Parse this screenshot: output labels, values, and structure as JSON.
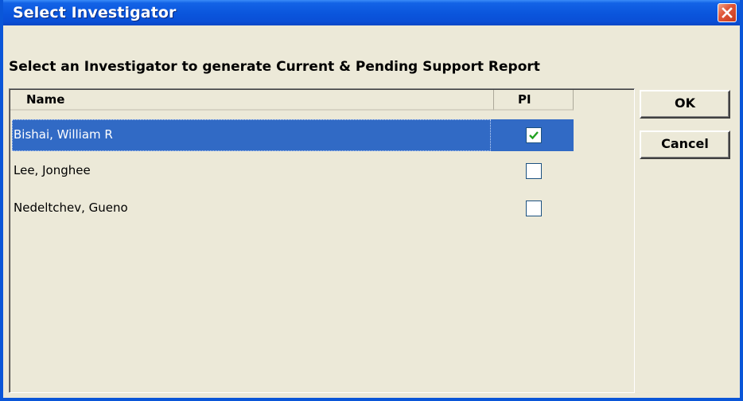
{
  "window": {
    "title": "Select Investigator"
  },
  "instructions": "Select an Investigator to generate Current & Pending Support Report",
  "list": {
    "columns": [
      "Name",
      "PI"
    ],
    "rows": [
      {
        "name": "Bishai, William R",
        "pi": true,
        "selected": true
      },
      {
        "name": "Lee, Jonghee",
        "pi": false,
        "selected": false
      },
      {
        "name": "Nedeltchev, Gueno",
        "pi": false,
        "selected": false
      }
    ]
  },
  "buttons": {
    "ok": "OK",
    "cancel": "Cancel"
  },
  "colors": {
    "titlebar": "#0a55dc",
    "selection": "#316ac5",
    "check": "#21a121",
    "close": "#e0583a",
    "dialog": "#ece9d8"
  }
}
